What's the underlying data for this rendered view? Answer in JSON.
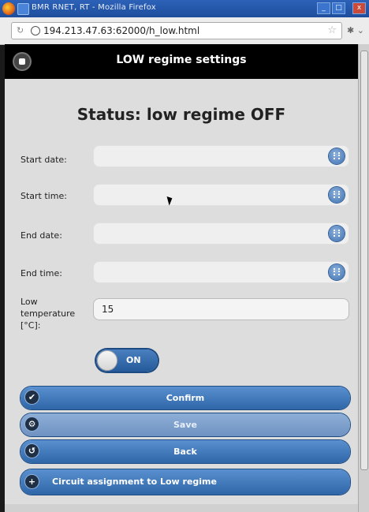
{
  "window": {
    "title": "BMR RNET, RT - Mozilla Firefox",
    "url": "194.213.47.63:62000/h_low.html"
  },
  "header": {
    "title": "LOW regime settings"
  },
  "status": {
    "text": "Status: low regime OFF"
  },
  "fields": {
    "start_date_label": "Start date:",
    "start_time_label": "Start time:",
    "end_date_label": "End date:",
    "end_time_label": "End time:",
    "low_temp_label_1": "Low",
    "low_temp_label_2": "temperature",
    "low_temp_label_3": "[°C]:",
    "low_temp_value": "15"
  },
  "toggle": {
    "label": "ON"
  },
  "buttons": {
    "confirm": "Confirm",
    "save": "Save",
    "back": "Back",
    "circuit": "Circuit assignment to Low regime"
  },
  "colors": {
    "accent": "#2e66a8",
    "header_bg": "#000000",
    "page_bg": "#dddddd"
  }
}
